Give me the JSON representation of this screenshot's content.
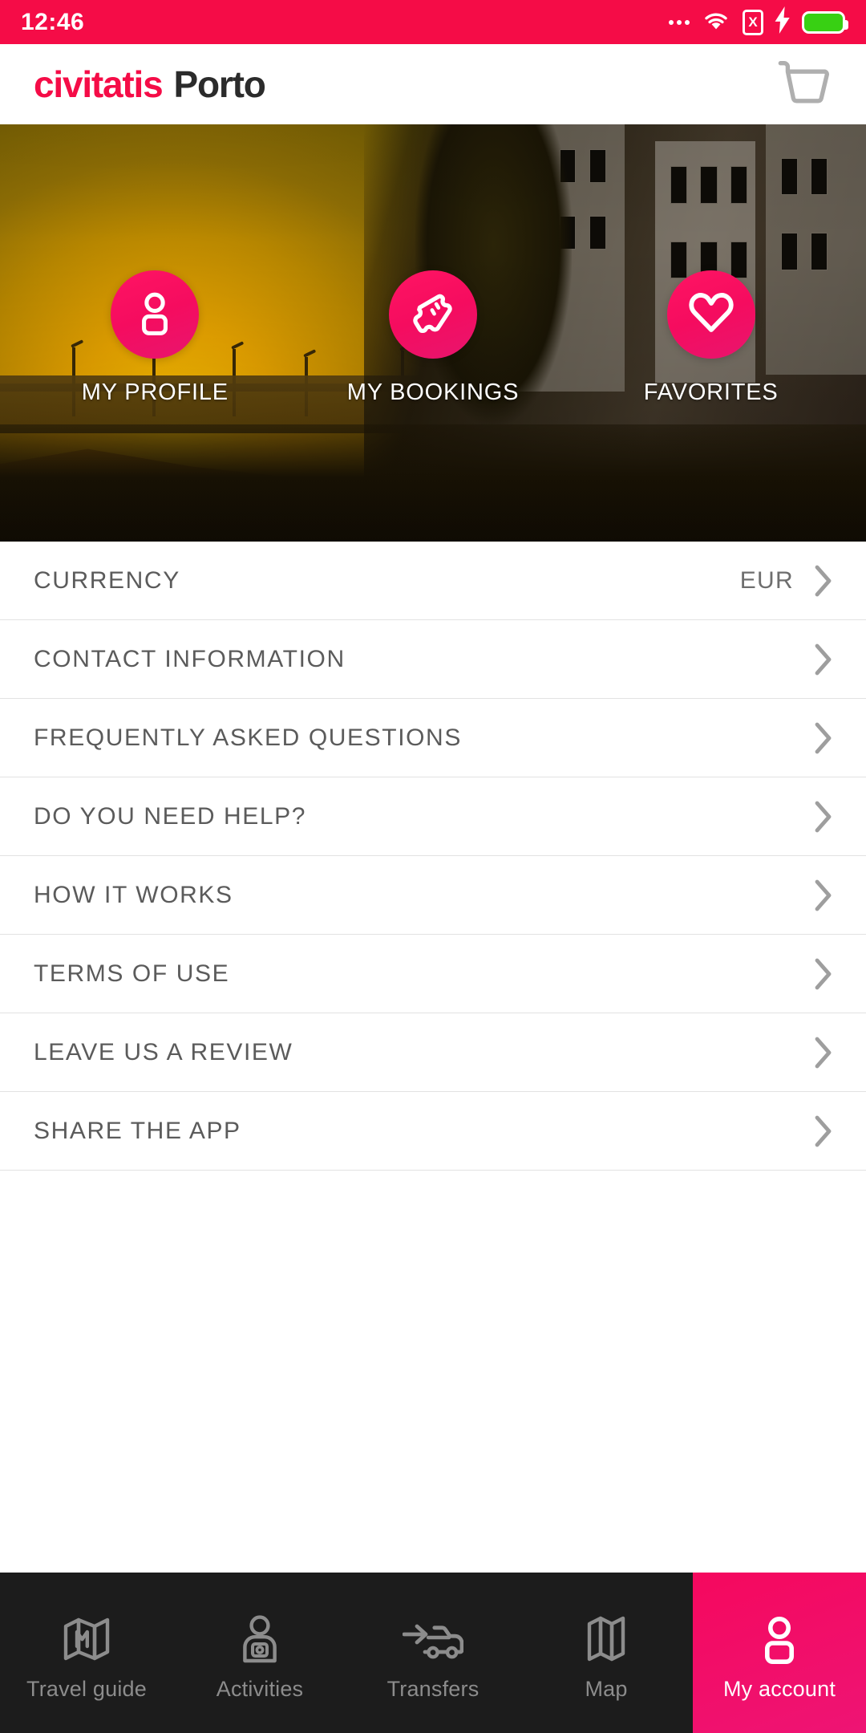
{
  "statusbar": {
    "time": "12:46",
    "icons": [
      "more-dots",
      "wifi-icon",
      "sim-card-x-icon",
      "charging-bolt-icon",
      "battery-icon"
    ],
    "background_color": "#F50C47"
  },
  "header": {
    "brand_primary": "civitatis",
    "brand_secondary": "Porto",
    "brand_primary_color": "#F50C47",
    "brand_secondary_color": "#2B2B2B",
    "cart_icon": "shopping-cart-icon"
  },
  "hero": {
    "image_description": "Porto riverside at sunset with Dom Luis bridge and Ribeira buildings",
    "accent_color": "#F50C5F",
    "quick_actions": [
      {
        "label": "MY PROFILE",
        "icon": "user-icon"
      },
      {
        "label": "MY BOOKINGS",
        "icon": "ticket-icon"
      },
      {
        "label": "FAVORITES",
        "icon": "heart-icon"
      }
    ]
  },
  "menu": {
    "rows": [
      {
        "label": "CURRENCY",
        "value": "EUR",
        "chevron": "chevron-right-icon"
      },
      {
        "label": "CONTACT INFORMATION",
        "value": "",
        "chevron": "chevron-right-icon"
      },
      {
        "label": "FREQUENTLY ASKED QUESTIONS",
        "value": "",
        "chevron": "chevron-right-icon"
      },
      {
        "label": "DO YOU NEED HELP?",
        "value": "",
        "chevron": "chevron-right-icon"
      },
      {
        "label": "HOW IT WORKS",
        "value": "",
        "chevron": "chevron-right-icon"
      },
      {
        "label": "TERMS OF USE",
        "value": "",
        "chevron": "chevron-right-icon"
      },
      {
        "label": "LEAVE US A REVIEW",
        "value": "",
        "chevron": "chevron-right-icon"
      },
      {
        "label": "SHARE THE APP",
        "value": "",
        "chevron": "chevron-right-icon"
      }
    ]
  },
  "bottom_nav": {
    "active_color": "#F5085E",
    "background_color": "#1C1C1C",
    "items": [
      {
        "label": "Travel guide",
        "icon": "folded-map-m-icon",
        "active": false
      },
      {
        "label": "Activities",
        "icon": "tour-guide-person-icon",
        "active": false
      },
      {
        "label": "Transfers",
        "icon": "car-arrow-icon",
        "active": false
      },
      {
        "label": "Map",
        "icon": "map-icon",
        "active": false
      },
      {
        "label": "My account",
        "icon": "user-icon",
        "active": true
      }
    ]
  }
}
